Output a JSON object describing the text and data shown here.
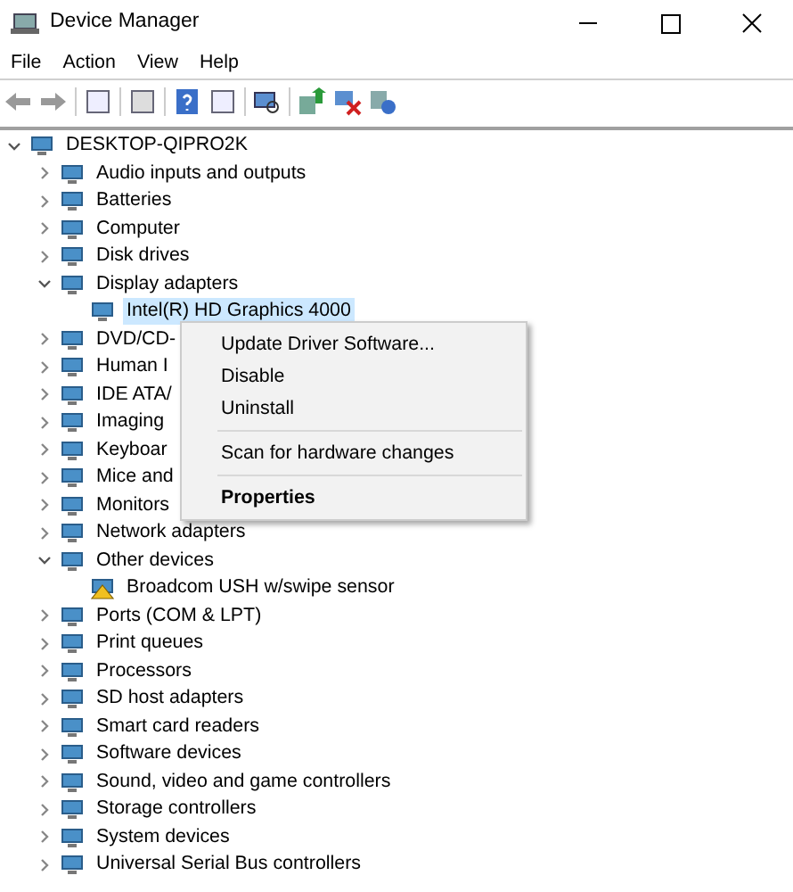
{
  "window": {
    "title": "Device Manager"
  },
  "menu_bar": [
    "File",
    "Action",
    "View",
    "Help"
  ],
  "tree": {
    "label": "DESKTOP-QIPRO2K",
    "expanded": true,
    "selected": false,
    "children": [
      {
        "label": "Audio inputs and outputs",
        "expanded": false,
        "selected": false
      },
      {
        "label": "Batteries",
        "expanded": false,
        "selected": false
      },
      {
        "label": "Computer",
        "expanded": false,
        "selected": false
      },
      {
        "label": "Disk drives",
        "expanded": false,
        "selected": false
      },
      {
        "label": "Display adapters",
        "expanded": true,
        "selected": false,
        "children": [
          {
            "label": "Intel(R) HD Graphics 4000",
            "selected": true,
            "warning": false
          }
        ]
      },
      {
        "label": "DVD/CD-",
        "expanded": false,
        "selected": false
      },
      {
        "label": "Human I",
        "expanded": false,
        "selected": false
      },
      {
        "label": "IDE ATA/",
        "expanded": false,
        "selected": false
      },
      {
        "label": "Imaging",
        "expanded": false,
        "selected": false
      },
      {
        "label": "Keyboar",
        "expanded": false,
        "selected": false
      },
      {
        "label": "Mice and",
        "expanded": false,
        "selected": false
      },
      {
        "label": "Monitors",
        "expanded": false,
        "selected": false
      },
      {
        "label": "Network adapters",
        "expanded": false,
        "selected": false
      },
      {
        "label": "Other devices",
        "expanded": true,
        "selected": false,
        "children": [
          {
            "label": "Broadcom USH w/swipe sensor",
            "selected": false,
            "warning": true
          }
        ]
      },
      {
        "label": "Ports (COM & LPT)",
        "expanded": false,
        "selected": false
      },
      {
        "label": "Print queues",
        "expanded": false,
        "selected": false
      },
      {
        "label": "Processors",
        "expanded": false,
        "selected": false
      },
      {
        "label": "SD host adapters",
        "expanded": false,
        "selected": false
      },
      {
        "label": "Smart card readers",
        "expanded": false,
        "selected": false
      },
      {
        "label": "Software devices",
        "expanded": false,
        "selected": false
      },
      {
        "label": "Sound, video and game controllers",
        "expanded": false,
        "selected": false
      },
      {
        "label": "Storage controllers",
        "expanded": false,
        "selected": false
      },
      {
        "label": "System devices",
        "expanded": false,
        "selected": false
      },
      {
        "label": "Universal Serial Bus controllers",
        "expanded": false,
        "selected": false
      }
    ]
  },
  "context_menu": [
    {
      "kind": "item",
      "label": "Update Driver Software...",
      "default": false
    },
    {
      "kind": "item",
      "label": "Disable",
      "default": false
    },
    {
      "kind": "item",
      "label": "Uninstall",
      "default": false
    },
    {
      "kind": "separator"
    },
    {
      "kind": "item",
      "label": "Scan for hardware changes",
      "default": false
    },
    {
      "kind": "separator"
    },
    {
      "kind": "item",
      "label": "Properties",
      "default": true
    }
  ]
}
